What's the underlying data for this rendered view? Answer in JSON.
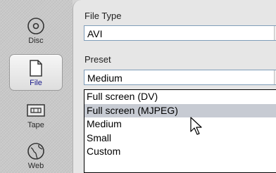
{
  "sidebar": {
    "items": [
      {
        "label": "Disc",
        "icon": "disc-icon",
        "active": false
      },
      {
        "label": "File",
        "icon": "file-icon",
        "active": true
      },
      {
        "label": "Tape",
        "icon": "tape-icon",
        "active": false
      },
      {
        "label": "Web",
        "icon": "web-globe-icon",
        "active": false
      }
    ]
  },
  "file_type": {
    "label": "File Type",
    "value": "AVI"
  },
  "preset": {
    "label": "Preset",
    "value": "Medium",
    "options": [
      "Full screen (DV)",
      "Full screen (MJPEG)",
      "Medium",
      "Small",
      "Custom"
    ],
    "highlighted": "Full screen (MJPEG)"
  },
  "colors": {
    "accent_label": "#1a1a8a",
    "highlight": "#c7cbd3",
    "field_border": "#7f9db9"
  }
}
